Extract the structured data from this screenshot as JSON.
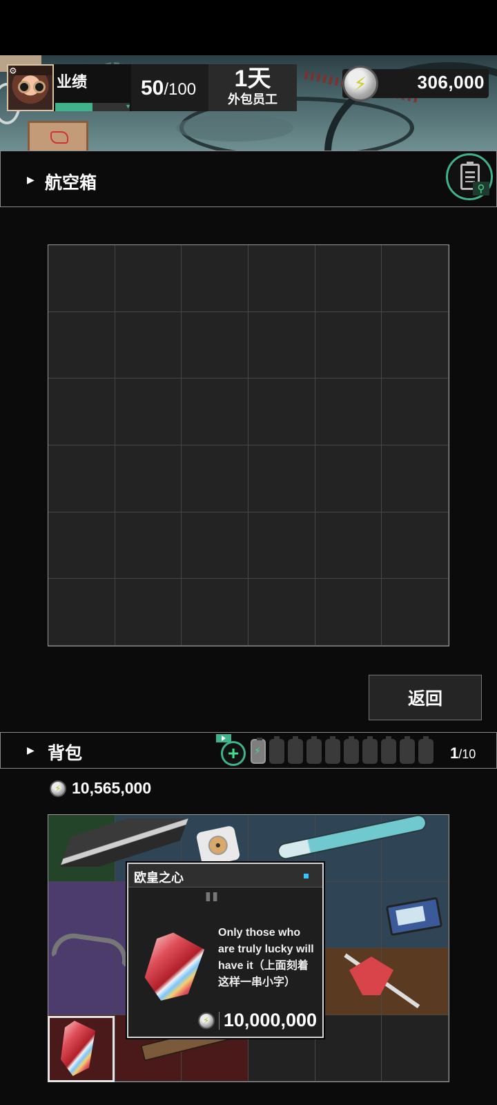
{
  "header": {
    "performance_label": "业绩",
    "performance_current": "50",
    "performance_max": "/100",
    "performance_progress": 0.5,
    "days_value": "1天",
    "employee_type": "外包员工",
    "coins": "306,000"
  },
  "flight_case": {
    "title": "航空箱",
    "grid": {
      "columns": 6,
      "rows": 6
    },
    "return_label": "返回"
  },
  "backpack": {
    "title": "背包",
    "batteries_filled": 1,
    "batteries_total": 10,
    "slots_current": "1",
    "slots_total": "/10",
    "coins": "10,565,000",
    "grid": {
      "columns": 6,
      "rows": 4
    },
    "cell_colors": [
      "green",
      "blue",
      "blue",
      "blue",
      "blue",
      "blue",
      "purple",
      "purple",
      "blue",
      "blue",
      "blue",
      "blue",
      "purple",
      "purple",
      "purple",
      "brown",
      "brown",
      "brown",
      "red",
      "red",
      "red",
      "dark",
      "dark",
      "dark"
    ]
  },
  "tooltip": {
    "name": "欧皇之心",
    "quote_mark": "\"",
    "description": "Only those who are truly lucky will have it（上面刻着这样一串小字）",
    "price": "10,000,000"
  },
  "colors": {
    "accent_green": "#3fb48a",
    "rarity_dot": "#35c6ff"
  }
}
